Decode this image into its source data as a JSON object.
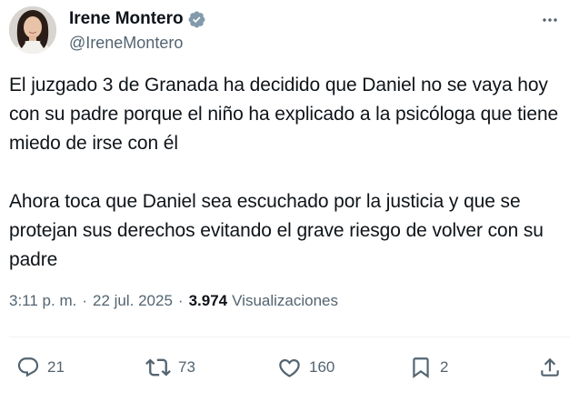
{
  "author": {
    "display_name": "Irene Montero",
    "handle": "@IreneMontero",
    "verified_color": "#829aab"
  },
  "tweet": {
    "paragraphs": [
      "El juzgado 3 de Granada ha decidido que Daniel no se vaya hoy con su padre porque el niño ha explicado a la psicóloga que tiene miedo de irse con él",
      "Ahora toca que Daniel sea escuchado por la justicia y que se protejan sus derechos evitando el grave riesgo de volver con su padre"
    ],
    "time": "3:11 p. m.",
    "separator": "·",
    "date": "22 jul. 2025",
    "views_count": "3.974",
    "views_label": "Visualizaciones"
  },
  "actions": {
    "replies": "21",
    "reposts": "73",
    "likes": "160",
    "bookmarks": "2"
  },
  "colors": {
    "text": "#0f1419",
    "secondary": "#536471",
    "divider": "#eff3f4"
  }
}
